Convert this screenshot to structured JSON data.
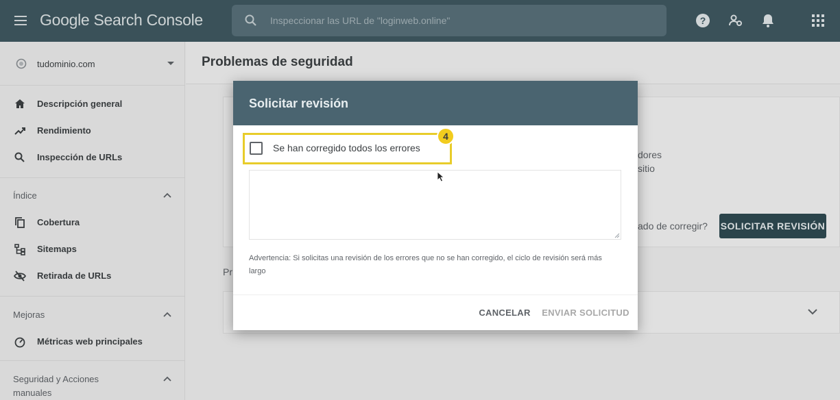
{
  "header": {
    "app_title": "Google Search Console",
    "search_placeholder": "Inspeccionar las URL de \"loginweb.online\""
  },
  "sidebar": {
    "property": "tudominio.com",
    "main_items": [
      {
        "label": "Descripción general",
        "icon": "home-icon"
      },
      {
        "label": "Rendimiento",
        "icon": "trending-up-icon"
      },
      {
        "label": "Inspección de URLs",
        "icon": "search-icon"
      }
    ],
    "sections": [
      {
        "title": "Índice",
        "items": [
          {
            "label": "Cobertura",
            "icon": "copy-icon"
          },
          {
            "label": "Sitemaps",
            "icon": "sitemap-icon"
          },
          {
            "label": "Retirada de URLs",
            "icon": "visibility-off-icon"
          }
        ]
      },
      {
        "title": "Mejoras",
        "items": [
          {
            "label": "Métricas web principales",
            "icon": "gauge-icon"
          }
        ]
      },
      {
        "title": "Seguridad y Acciones manuales",
        "items": []
      }
    ]
  },
  "main": {
    "page_title": "Problemas de seguridad",
    "card_text_line1": "dores",
    "card_text_line2": "sitio",
    "card_question": "ado de corregir?",
    "request_button": "SOLICITAR REVISIÓN",
    "partial_label": "Pr"
  },
  "dialog": {
    "title": "Solicitar revisión",
    "checkbox_label": "Se han corregido todos los errores",
    "checkbox_checked": false,
    "step_number": "4",
    "textarea_value": "",
    "warning": "Advertencia: Si solicitas una revisión de los errores que no se han corregido, el ciclo de revisión será más largo",
    "cancel_label": "CANCELAR",
    "send_label": "ENVIAR SOLICITUD"
  },
  "colors": {
    "topbar": "#3f5861",
    "dialog_header": "#4a6470",
    "highlight": "#e8cc2a",
    "primary_button": "#2f4a52"
  }
}
